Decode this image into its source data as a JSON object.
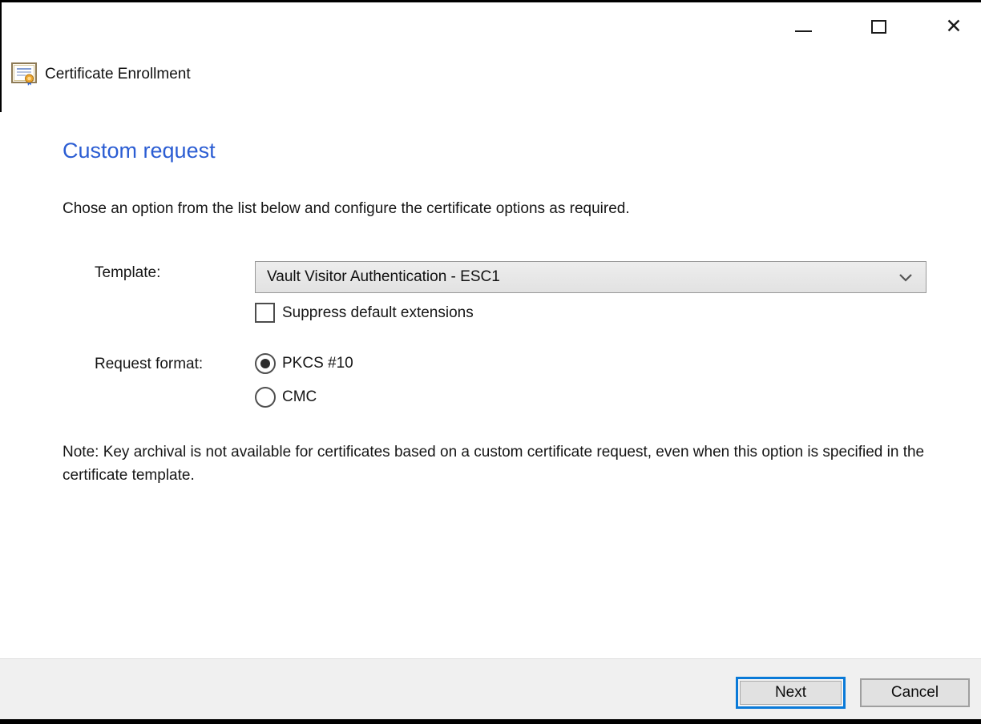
{
  "window": {
    "title": "Certificate Enrollment",
    "icon": "certificate-enrollment-icon",
    "controls": {
      "minimize": "minimize-icon",
      "maximize": "maximize-icon",
      "close_glyph": "✕"
    }
  },
  "content": {
    "heading": "Custom request",
    "description": "Chose an option from the list below and configure the certificate options as required.",
    "template": {
      "label": "Template:",
      "selected_value": "Vault Visitor Authentication - ESC1",
      "dropdown_icon": "chevron-down-icon"
    },
    "suppress_extensions": {
      "label": "Suppress default extensions",
      "checked": false
    },
    "request_format": {
      "label": "Request format:",
      "options": [
        {
          "label": "PKCS #10",
          "selected": true
        },
        {
          "label": "CMC",
          "selected": false
        }
      ]
    },
    "note": "Note: Key archival is not available for certificates based on a custom certificate request, even when this option is specified in the certificate template."
  },
  "footer": {
    "next_label": "Next",
    "cancel_label": "Cancel"
  },
  "colors": {
    "heading_blue": "#2b5dd3",
    "focus_blue": "#0078d7",
    "footer_gray": "#f0f0f0",
    "button_face": "#e1e1e1",
    "dropdown_face": "#e8e8e8",
    "capture_bar": "#000000"
  }
}
